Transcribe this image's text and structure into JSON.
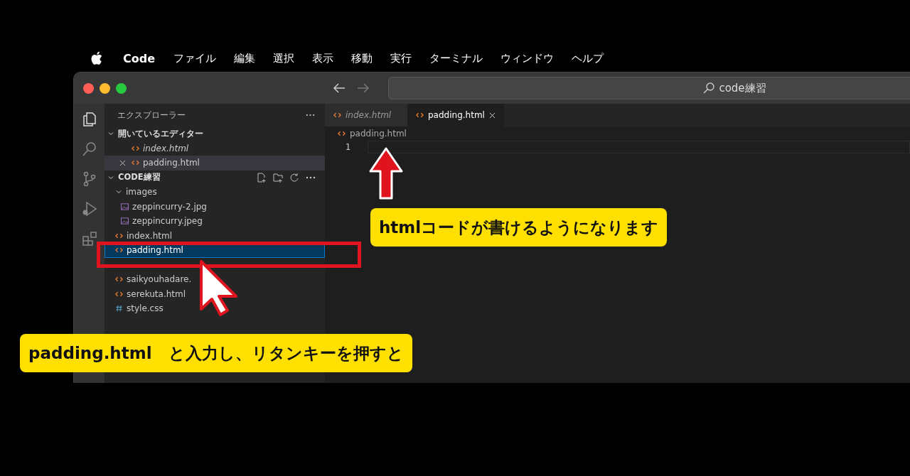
{
  "menubar": {
    "app": "Code",
    "menus": [
      "ファイル",
      "編集",
      "選択",
      "表示",
      "移動",
      "実行",
      "ターミナル",
      "ウィンドウ",
      "ヘルプ"
    ]
  },
  "titlebar": {
    "search": "code練習"
  },
  "sidebar": {
    "title": "エクスプローラー",
    "open_editors": {
      "label": "開いているエディター",
      "expanded": true,
      "items": [
        {
          "name": "index.html",
          "preview": true,
          "hovered": false
        },
        {
          "name": "padding.html",
          "preview": false,
          "hovered": true
        }
      ]
    },
    "project": {
      "label": "CODE練習",
      "expanded": true,
      "items": [
        {
          "name": "images",
          "kind": "folder",
          "expanded": true,
          "selected": false,
          "children": [
            {
              "name": "zeppincurry-2.jpg",
              "kind": "image",
              "selected": false
            },
            {
              "name": "zeppincurry.jpeg",
              "kind": "image",
              "selected": false
            }
          ]
        },
        {
          "name": "index.html",
          "kind": "html",
          "selected": false
        },
        {
          "name": "padding.html",
          "kind": "html",
          "selected": true
        },
        {
          "name": "saikyouhadare.",
          "kind": "html",
          "selected": false
        },
        {
          "name": "serekuta.html",
          "kind": "html",
          "selected": false
        },
        {
          "name": "style.css",
          "kind": "css",
          "selected": false
        }
      ]
    }
  },
  "tabs": [
    {
      "label": "index.html",
      "selected": false,
      "preview": true
    },
    {
      "label": "padding.html",
      "selected": true,
      "preview": false
    }
  ],
  "editor": {
    "breadcrumb": "padding.html",
    "lines": [
      "1"
    ]
  },
  "callouts": [
    "htmlコードが書けるようになります",
    "padding.html　と入力し、リタンキーを押すと"
  ]
}
